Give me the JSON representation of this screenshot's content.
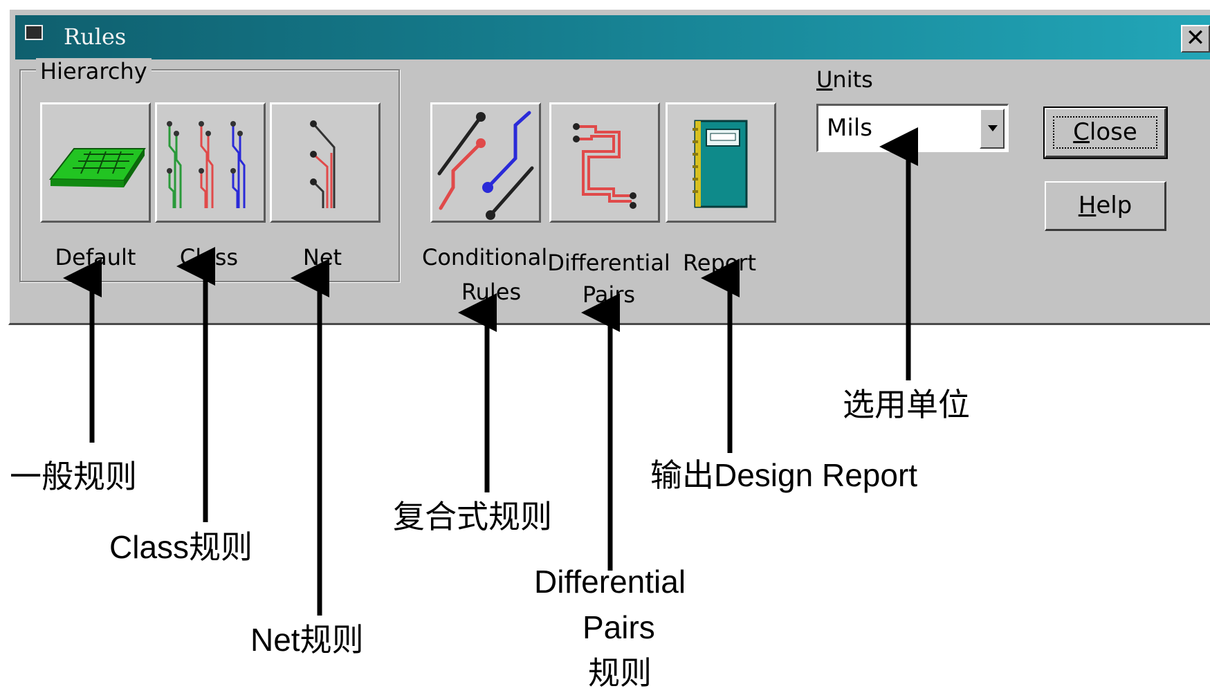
{
  "window": {
    "title": "Rules",
    "close_glyph": "✕",
    "icon": "app-window-icon"
  },
  "hierarchy": {
    "label": "Hierarchy",
    "buttons": [
      {
        "label": "Default",
        "icon": "board-icon"
      },
      {
        "label": "Class",
        "icon": "class-traces-icon"
      },
      {
        "label": "Net",
        "icon": "net-trace-icon"
      }
    ]
  },
  "tools": [
    {
      "label_line1": "Conditional",
      "label_line2": "Rules",
      "icon": "conditional-rules-icon"
    },
    {
      "label_line1": "Differential",
      "label_line2": "Pairs",
      "icon": "differential-pairs-icon"
    },
    {
      "label_line1": "Report",
      "label_line2": "",
      "icon": "report-icon"
    }
  ],
  "units": {
    "label_first": "U",
    "label_rest": "nits",
    "value": "Mils"
  },
  "actions": {
    "close_first": "C",
    "close_rest": "lose",
    "help_first": "H",
    "help_rest": "elp"
  },
  "annotations": {
    "default": "一般规则",
    "class": "Class规则",
    "net": "Net规则",
    "conditional": "复合式规则",
    "diff_line1": "Differential",
    "diff_line2": "Pairs",
    "diff_line3": "规则",
    "report": "输出Design Report",
    "units": "选用单位"
  },
  "colors": {
    "dialog_bg": "#c3c3c3",
    "title_start": "#0f5f6e",
    "title_end": "#22a6b8",
    "trace_red": "#e04a4a",
    "trace_blue": "#2a2ad8",
    "trace_green": "#2a9a3a",
    "board_green": "#22c422",
    "report_teal": "#0e8a8a"
  }
}
